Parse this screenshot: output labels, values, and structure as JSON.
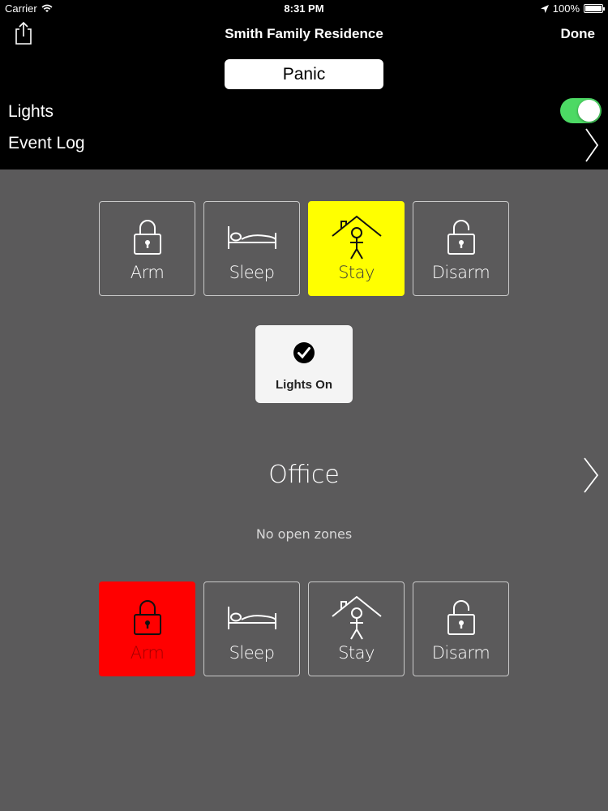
{
  "status_bar": {
    "carrier": "Carrier",
    "time": "8:31 PM",
    "battery": "100%"
  },
  "nav": {
    "title": "Smith Family Residence",
    "done_label": "Done"
  },
  "header": {
    "panic_label": "Panic",
    "lights_label": "Lights",
    "lights_on": true,
    "event_log_label": "Event Log"
  },
  "system_modes": {
    "selected": "Stay",
    "selected_color": "#ffff00",
    "tiles": [
      {
        "label": "Arm",
        "icon": "lock-closed-icon"
      },
      {
        "label": "Sleep",
        "icon": "bed-icon"
      },
      {
        "label": "Stay",
        "icon": "house-person-icon"
      },
      {
        "label": "Disarm",
        "icon": "lock-open-icon"
      }
    ]
  },
  "lights_on_button": {
    "label": "Lights On",
    "icon": "checkmark-circle-icon"
  },
  "area": {
    "name": "Office",
    "zones_status": "No open zones",
    "selected": "Arm",
    "selected_color": "#ff0000",
    "tiles": [
      {
        "label": "Arm",
        "icon": "lock-closed-icon"
      },
      {
        "label": "Sleep",
        "icon": "bed-icon"
      },
      {
        "label": "Stay",
        "icon": "house-person-icon"
      },
      {
        "label": "Disarm",
        "icon": "lock-open-icon"
      }
    ]
  }
}
